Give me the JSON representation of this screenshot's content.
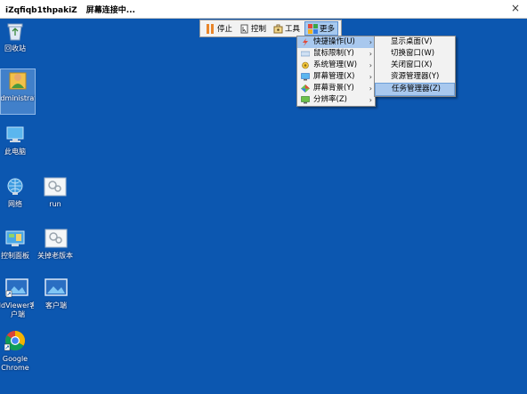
{
  "window": {
    "title": "iZqfiqb1thpakiZ",
    "status": "屏幕连接中...",
    "close_symbol": "×"
  },
  "toolbar": {
    "stop_label": "停止",
    "control_label": "控制",
    "tools_label": "工具",
    "more_label": "更多"
  },
  "menu_main": {
    "items": [
      {
        "label": "快捷操作(U)",
        "icon": "lightning-icon"
      },
      {
        "label": "鼠标限制(Y)",
        "icon": "mouse-limit-icon"
      },
      {
        "label": "系统管理(W)",
        "icon": "system-manage-icon"
      },
      {
        "label": "屏幕管理(X)",
        "icon": "screen-manage-icon"
      },
      {
        "label": "屏幕背景(Y)",
        "icon": "screen-background-icon"
      },
      {
        "label": "分辨率(Z)",
        "icon": "resolution-icon"
      }
    ],
    "arrow": "›"
  },
  "menu_sub": {
    "items": [
      {
        "label": "显示桌面(V)"
      },
      {
        "label": "切换窗口(W)"
      },
      {
        "label": "关闭窗口(X)"
      },
      {
        "label": "资源管理器(Y)"
      },
      {
        "label": "任务管理器(Z)"
      }
    ]
  },
  "desktop": {
    "icons": [
      {
        "label": "回收站",
        "icon": "recycle-bin-icon"
      },
      {
        "label": "Administrator",
        "icon": "user-folder-icon"
      },
      {
        "label": "此电脑",
        "icon": "this-pc-icon"
      },
      {
        "label": "网络",
        "icon": "network-icon"
      },
      {
        "label": "run",
        "icon": "run-icon"
      },
      {
        "label": "控制面板",
        "icon": "control-panel-icon"
      },
      {
        "label": "关掉老版本",
        "icon": "shortcut-icon"
      },
      {
        "label": "IdViewer客户端",
        "icon": "viewer-client-icon"
      },
      {
        "label": "客户端",
        "icon": "client-icon"
      },
      {
        "label": "Google Chrome",
        "icon": "chrome-icon"
      }
    ]
  },
  "colors": {
    "desktop_bg": "#0c57b0",
    "menu_highlight": "#a8c8ee",
    "toolbar_bg": "#f2f2f2"
  }
}
